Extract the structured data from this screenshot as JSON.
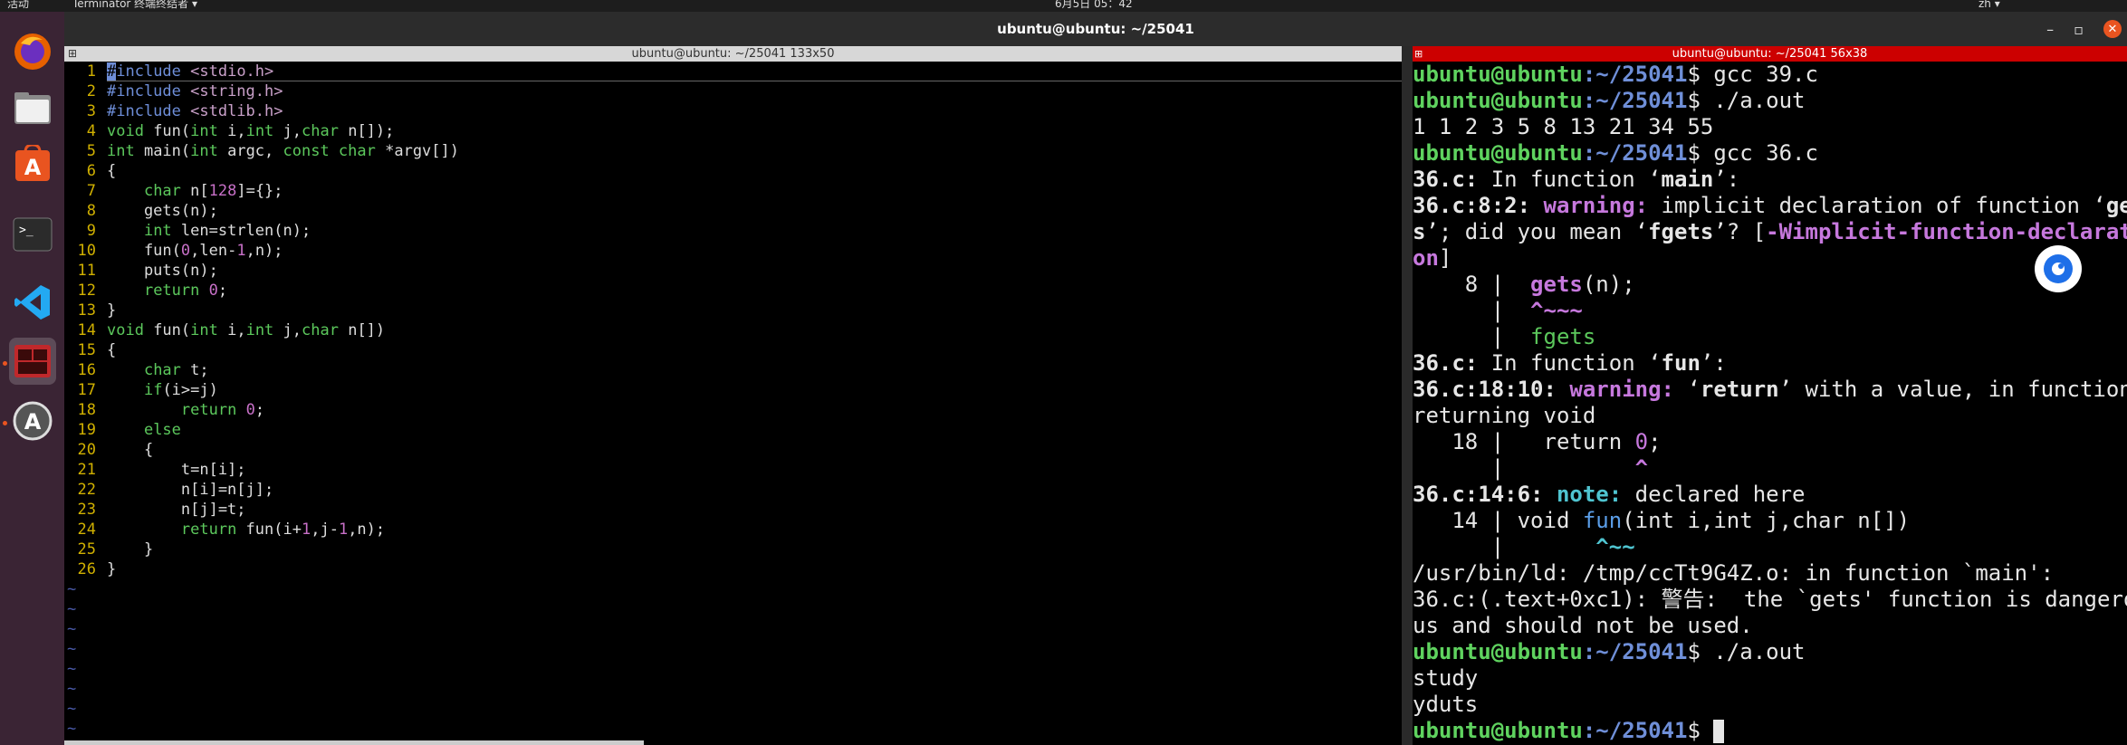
{
  "topbar": {
    "activities": "活动",
    "app_menu": "Terminator 终端终结者 ▾",
    "clock": "6月5日 05：42",
    "input_method": "zh ▾"
  },
  "window": {
    "title": "ubuntu@ubuntu: ~/25041"
  },
  "left_terminal": {
    "title": "ubuntu@ubuntu: ~/25041 133x50",
    "code": [
      {
        "n": "1",
        "t": "#include <stdio.h>"
      },
      {
        "n": "2",
        "t": "#include <string.h>"
      },
      {
        "n": "3",
        "t": "#include <stdlib.h>"
      },
      {
        "n": "4",
        "t": "void fun(int i,int j,char n[]);"
      },
      {
        "n": "5",
        "t": "int main(int argc, const char *argv[])"
      },
      {
        "n": "6",
        "t": "{"
      },
      {
        "n": "7",
        "t": "    char n[128]={};"
      },
      {
        "n": "8",
        "t": "    gets(n);"
      },
      {
        "n": "9",
        "t": "    int len=strlen(n);"
      },
      {
        "n": "10",
        "t": "    fun(0,len-1,n);"
      },
      {
        "n": "11",
        "t": "    puts(n);"
      },
      {
        "n": "12",
        "t": "    return 0;"
      },
      {
        "n": "13",
        "t": "}"
      },
      {
        "n": "14",
        "t": "void fun(int i,int j,char n[])"
      },
      {
        "n": "15",
        "t": "{"
      },
      {
        "n": "16",
        "t": "    char t;"
      },
      {
        "n": "17",
        "t": "    if(i>=j)"
      },
      {
        "n": "18",
        "t": "        return 0;"
      },
      {
        "n": "19",
        "t": "    else"
      },
      {
        "n": "20",
        "t": "    {"
      },
      {
        "n": "21",
        "t": "        t=n[i];"
      },
      {
        "n": "22",
        "t": "        n[i]=n[j];"
      },
      {
        "n": "23",
        "t": "        n[j]=t;"
      },
      {
        "n": "24",
        "t": "        return fun(i+1,j-1,n);"
      },
      {
        "n": "25",
        "t": "    }"
      },
      {
        "n": "26",
        "t": "}"
      }
    ],
    "tilde": "~"
  },
  "right_terminal": {
    "title": "ubuntu@ubuntu: ~/25041 56x38",
    "prompt_user": "ubuntu@ubuntu",
    "prompt_path": ":~/25041",
    "prompt_dollar": "$ ",
    "cmd1": "gcc 39.c",
    "cmd2": "./a.out",
    "out1": "1 1 2 3 5 8 13 21 34 55",
    "cmd3": "gcc 36.c",
    "l_infn_main_a": "36.c:",
    "l_infn_main_b": " In function ‘",
    "l_infn_main_c": "main",
    "l_infn_main_d": "’:",
    "w1_loc": "36.c:8:2:",
    "w1_kw": " warning:",
    "w1_a": " implicit declaration of function ‘",
    "w1_b": "get",
    "w2_a": "s",
    "w2_b": "’; did you mean ‘",
    "w2_c": "fgets",
    "w2_d": "’? [",
    "w2_e": "-Wimplicit-function-declarati",
    "w3_a": "on",
    "w3_b": "]",
    "s1_num": "    8 | ",
    "s1_code": " gets",
    "s1_rest": "(n);",
    "s2_bar": "      | ",
    "s2_caret": " ^~~~",
    "s3_bar": "      | ",
    "s3_fix": " fgets",
    "l_infn_fun_a": "36.c:",
    "l_infn_fun_b": " In function ‘",
    "l_infn_fun_c": "fun",
    "l_infn_fun_d": "’:",
    "w4_loc": "36.c:18:10:",
    "w4_kw": " warning:",
    "w4_a": " ‘",
    "w4_b": "return",
    "w4_c": "’ with a value, in function",
    "w5": "returning void",
    "s4_num": "   18 | ",
    "s4_code": "  return ",
    "s4_zero": "0",
    "s4_end": ";",
    "s5_bar": "      | ",
    "s5_caret": "         ^",
    "n1_loc": "36.c:14:6:",
    "n1_kw": " note:",
    "n1_a": " declared here",
    "s6_num": "   14 | ",
    "s6_a": "void ",
    "s6_fn": "fun",
    "s6_b": "(int i,int j,char n[])",
    "s7_bar": "      | ",
    "s7_caret": "      ^~~",
    "ld1": "/usr/bin/ld: /tmp/ccTt9G4Z.o: in function `main':",
    "ld2": "36.c:(.text+0xc1): 警告:  the `gets' function is dangero",
    "ld3": "us and should not be used.",
    "cmd4": "./a.out",
    "out2": "study",
    "out3": "yduts"
  },
  "dock": {
    "items": [
      "firefox-icon",
      "files-icon",
      "app-store-icon",
      "terminal-icon",
      "vscode-icon",
      "terminator-icon",
      "software-updater-icon"
    ]
  }
}
